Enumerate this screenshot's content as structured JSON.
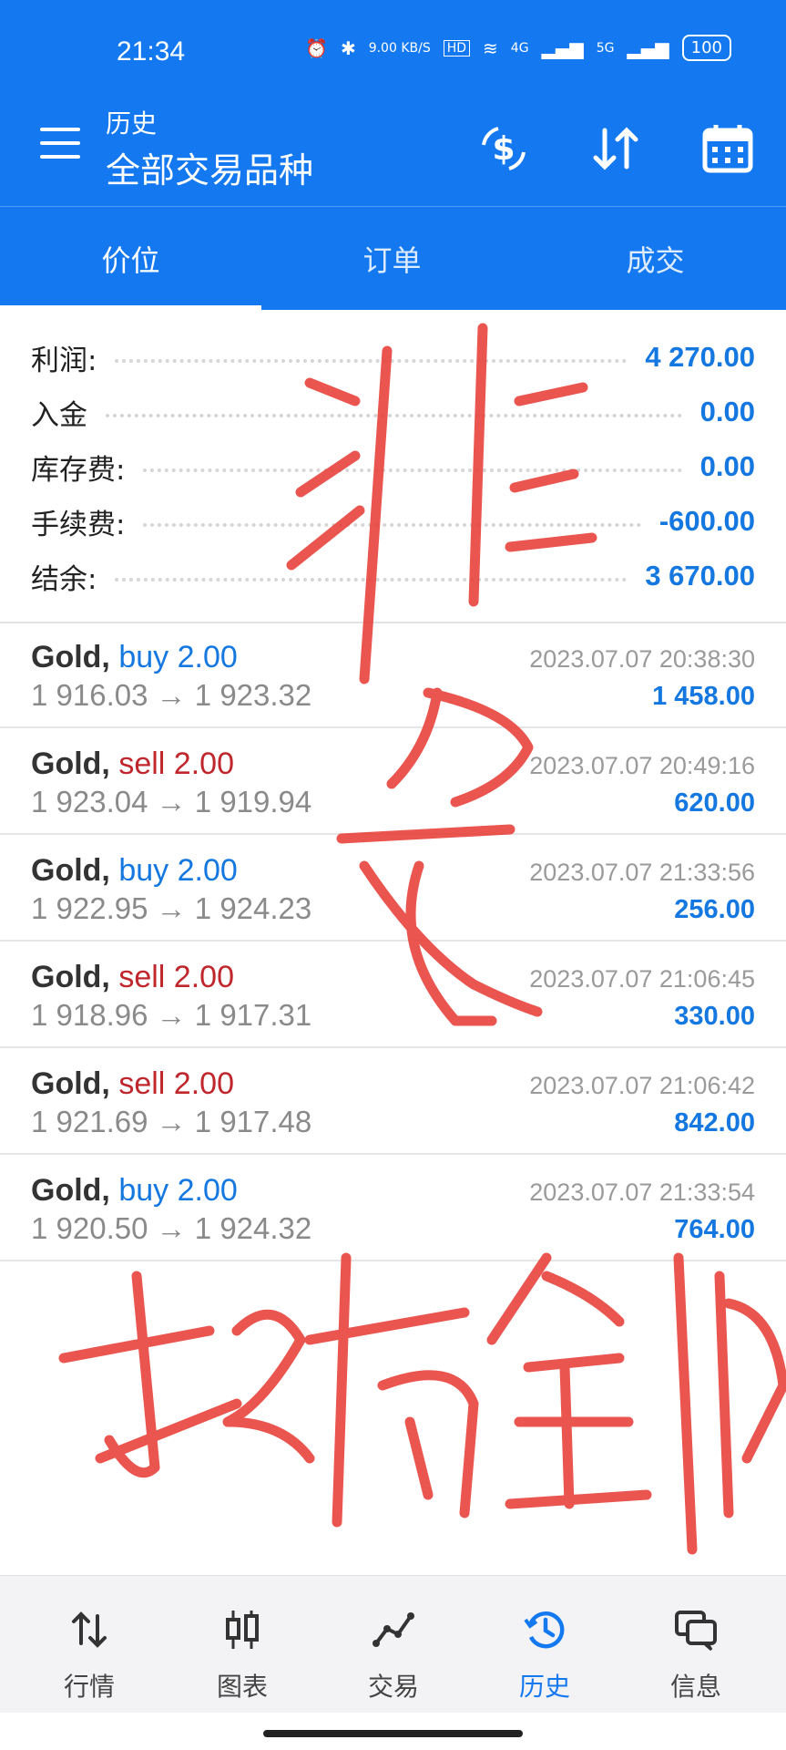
{
  "status_bar": {
    "time": "21:34",
    "speed": "9.00 KB/S",
    "hd_label": "HD",
    "net1": "4G",
    "net2": "5G",
    "battery": "100"
  },
  "app_bar": {
    "title": "历史",
    "subtitle": "全部交易品种"
  },
  "tabs": [
    {
      "label": "价位",
      "active": true
    },
    {
      "label": "订单",
      "active": false
    },
    {
      "label": "成交",
      "active": false
    }
  ],
  "summary": [
    {
      "label": "利润:",
      "value": "4 270.00"
    },
    {
      "label": "入金",
      "value": "0.00"
    },
    {
      "label": "库存费:",
      "value": "0.00"
    },
    {
      "label": "手续费:",
      "value": "-600.00"
    },
    {
      "label": "结余:",
      "value": "3 670.00"
    }
  ],
  "trades": [
    {
      "symbol": "Gold,",
      "direction": "buy 2.00",
      "type": "buy",
      "prices": "1 916.03 → 1 923.32",
      "time": "2023.07.07 20:38:30",
      "profit": "1 458.00"
    },
    {
      "symbol": "Gold,",
      "direction": "sell 2.00",
      "type": "sell",
      "prices": "1 923.04 → 1 919.94",
      "time": "2023.07.07 20:49:16",
      "profit": "620.00"
    },
    {
      "symbol": "Gold,",
      "direction": "buy 2.00",
      "type": "buy",
      "prices": "1 922.95 → 1 924.23",
      "time": "2023.07.07 21:33:56",
      "profit": "256.00"
    },
    {
      "symbol": "Gold,",
      "direction": "sell 2.00",
      "type": "sell",
      "prices": "1 918.96 → 1 917.31",
      "time": "2023.07.07 21:06:45",
      "profit": "330.00"
    },
    {
      "symbol": "Gold,",
      "direction": "sell 2.00",
      "type": "sell",
      "prices": "1 921.69 → 1 917.48",
      "time": "2023.07.07 21:06:42",
      "profit": "842.00"
    },
    {
      "symbol": "Gold,",
      "direction": "buy 2.00",
      "type": "buy",
      "prices": "1 920.50 → 1 924.32",
      "time": "2023.07.07 21:33:54",
      "profit": "764.00"
    }
  ],
  "bottom_nav": [
    {
      "label": "行情",
      "icon": "quotes-arrows-icon",
      "active": false
    },
    {
      "label": "图表",
      "icon": "candlestick-icon",
      "active": false
    },
    {
      "label": "交易",
      "icon": "trade-line-icon",
      "active": false
    },
    {
      "label": "历史",
      "icon": "history-clock-icon",
      "active": true
    },
    {
      "label": "信息",
      "icon": "messages-icon",
      "active": false
    }
  ],
  "colors": {
    "primary": "#1479f0",
    "profit_blue": "#1478e0",
    "sell_red": "#c0272d",
    "handwriting_red": "#e8443c"
  }
}
